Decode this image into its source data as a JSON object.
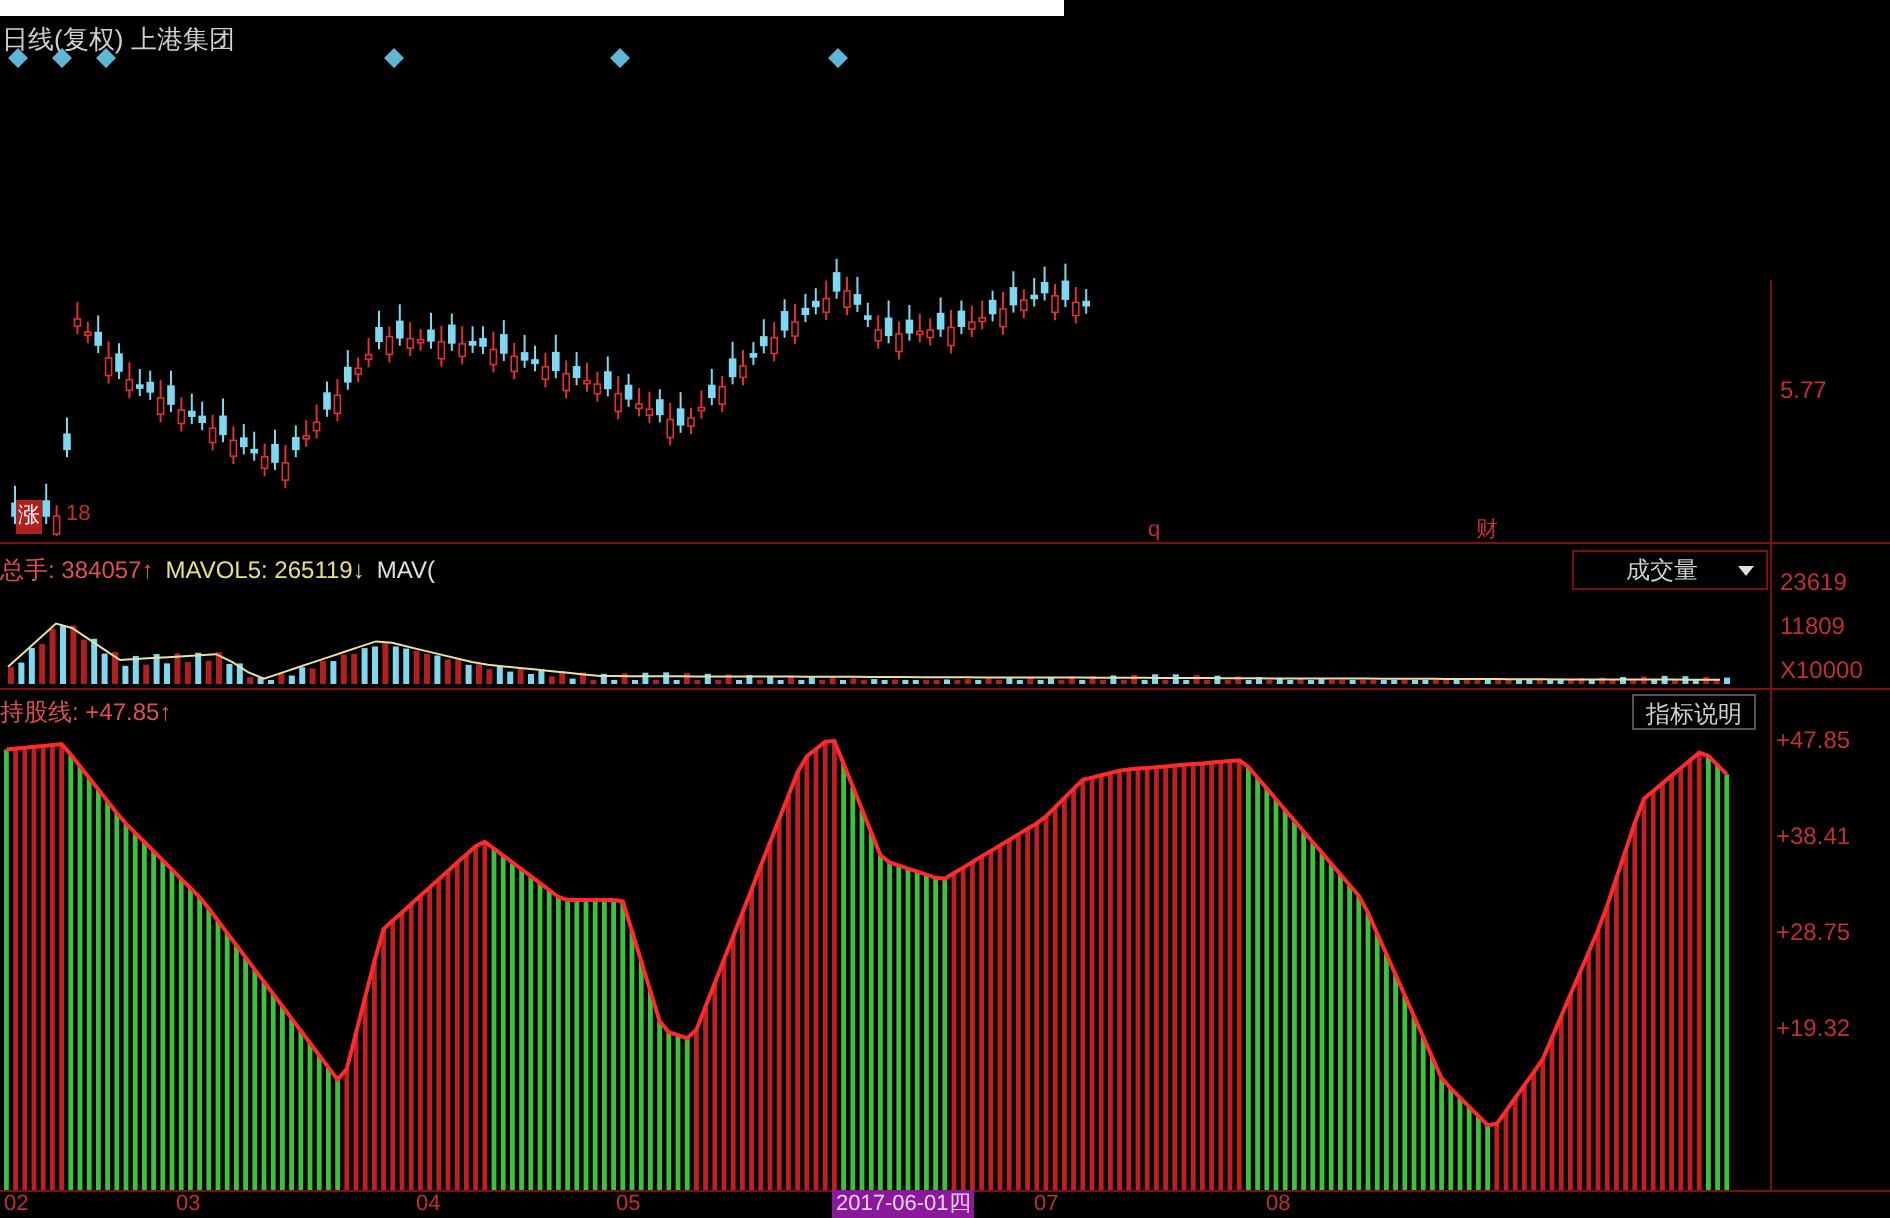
{
  "title": "日线(复权) 上港集团",
  "price_chart": {
    "markers": [
      {
        "kind": "tag",
        "text": "涨"
      },
      {
        "kind": "plain",
        "text": "18"
      },
      {
        "kind": "plain",
        "text": "q"
      },
      {
        "kind": "plain",
        "text": "财"
      }
    ],
    "axis": [
      "5.77"
    ]
  },
  "volume": {
    "label": "总手: 384057↑",
    "ma5_label": "MAVOL5: 265119↓",
    "ma10_label": "MAV(",
    "selector": "成交量",
    "axis": [
      "23619",
      "11809",
      "X10000"
    ]
  },
  "indicator": {
    "label": "持股线: +47.85↑",
    "button": "指标说明",
    "axis": [
      "+47.85",
      "+38.41",
      "+28.75",
      "+19.32"
    ]
  },
  "date_axis": [
    {
      "label": "02",
      "selected": false
    },
    {
      "label": "03",
      "selected": false
    },
    {
      "label": "04",
      "selected": false
    },
    {
      "label": "05",
      "selected": false
    },
    {
      "label": "2017-06-01四",
      "selected": true
    },
    {
      "label": "07",
      "selected": false
    },
    {
      "label": "08",
      "selected": false
    }
  ]
}
